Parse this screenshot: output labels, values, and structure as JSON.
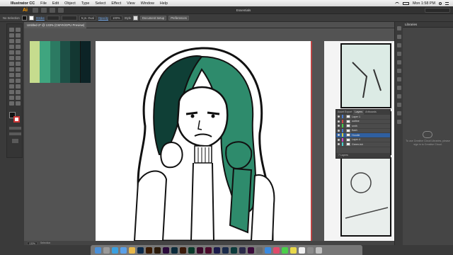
{
  "menubar": {
    "app_name": "Illustrator CC",
    "items": [
      "File",
      "Edit",
      "Object",
      "Type",
      "Select",
      "Effect",
      "View",
      "Window",
      "Help"
    ],
    "time": "Mon 1:58 PM"
  },
  "appbar": {
    "logo": "Ai",
    "workspace": "Essentials"
  },
  "control_bar": {
    "selection": "No Selection",
    "stroke_label": "Stroke",
    "brush_value": "5 pt. Oval",
    "opacity_label": "Opacity",
    "opacity_value": "100%",
    "style_label": "Style",
    "document_setup": "Document Setup",
    "preferences": "Preferences"
  },
  "document": {
    "tab_title": "Untitled-2* @ 133% (CMYK/GPU Preview)",
    "zoom": "133%",
    "tool": "Selection"
  },
  "swatches": [
    "#c6dc8e",
    "#3fa57f",
    "#2c7a62",
    "#1d5046",
    "#133732",
    "#0c2326"
  ],
  "layers_panel": {
    "tabs": [
      "Asset Export",
      "Layers",
      "Artboards"
    ],
    "active_tab": "Layers",
    "layers": [
      {
        "name": "Layer 1",
        "color": "#4a7bd0",
        "selected": false
      },
      {
        "name": "outline",
        "color": "#d04a4a",
        "selected": false
      },
      {
        "name": "smth",
        "color": "#4ad04a",
        "selected": false
      },
      {
        "name": "flush",
        "color": "#4a7bd0",
        "selected": false
      },
      {
        "name": "Hoodie",
        "color": "#d0d04a",
        "selected": true
      },
      {
        "name": "Layer 4",
        "color": "#d04ad0",
        "selected": false
      },
      {
        "name": "Green-ish",
        "color": "#4ad0d0",
        "selected": false
      }
    ],
    "footer": "7 Layers"
  },
  "libraries_panel": {
    "title": "Libraries",
    "message": "To use Creative Cloud Libraries, please sign in to Creative Cloud."
  },
  "colors": {
    "hair": "#2e8b6c",
    "dark_hair": "#0f3f36",
    "accent": "#ff9a00",
    "selection": "#2f5fa0"
  },
  "dock_icons": [
    "finder-icon",
    "launchpad-icon",
    "safari-icon",
    "mail-icon",
    "photos-icon",
    "photoshop-icon",
    "illustrator-icon",
    "bridge-icon",
    "premiere-icon",
    "lightroom-icon",
    "animate-icon",
    "dreamweaver-icon",
    "incopy-icon",
    "indesign-icon",
    "media-encoder-icon",
    "muse-icon",
    "audition-icon",
    "character-animator-icon",
    "xd-icon",
    "spark-icon",
    "app-store-icon",
    "music-icon",
    "messages-icon",
    "notes-icon",
    "calendar-icon",
    "settings-icon",
    "trash-icon"
  ]
}
